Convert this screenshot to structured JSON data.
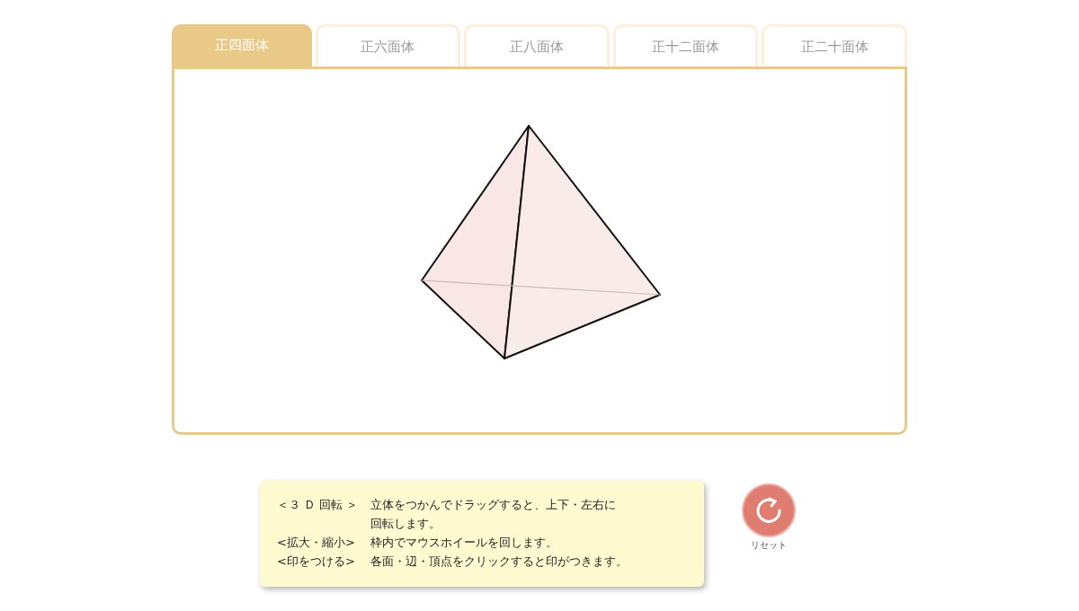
{
  "tabs": [
    {
      "label": "正四面体",
      "selected": true
    },
    {
      "label": "正六面体",
      "selected": false
    },
    {
      "label": "正八面体",
      "selected": false
    },
    {
      "label": "正十二面体",
      "selected": false
    },
    {
      "label": "正二十面体",
      "selected": false
    }
  ],
  "help": [
    {
      "label": "＜３ Ｄ 回転 ＞",
      "lines": [
        "立体をつかんでドラッグすると、上下・左右に",
        "回転します。"
      ]
    },
    {
      "label": "<拡大・縮小>",
      "lines": [
        "枠内でマウスホイールを回します。"
      ]
    },
    {
      "label": "<印をつける>",
      "lines": [
        "各面・辺・頂点をクリックすると印がつきます。"
      ]
    }
  ],
  "reset": {
    "label": "リセット"
  }
}
